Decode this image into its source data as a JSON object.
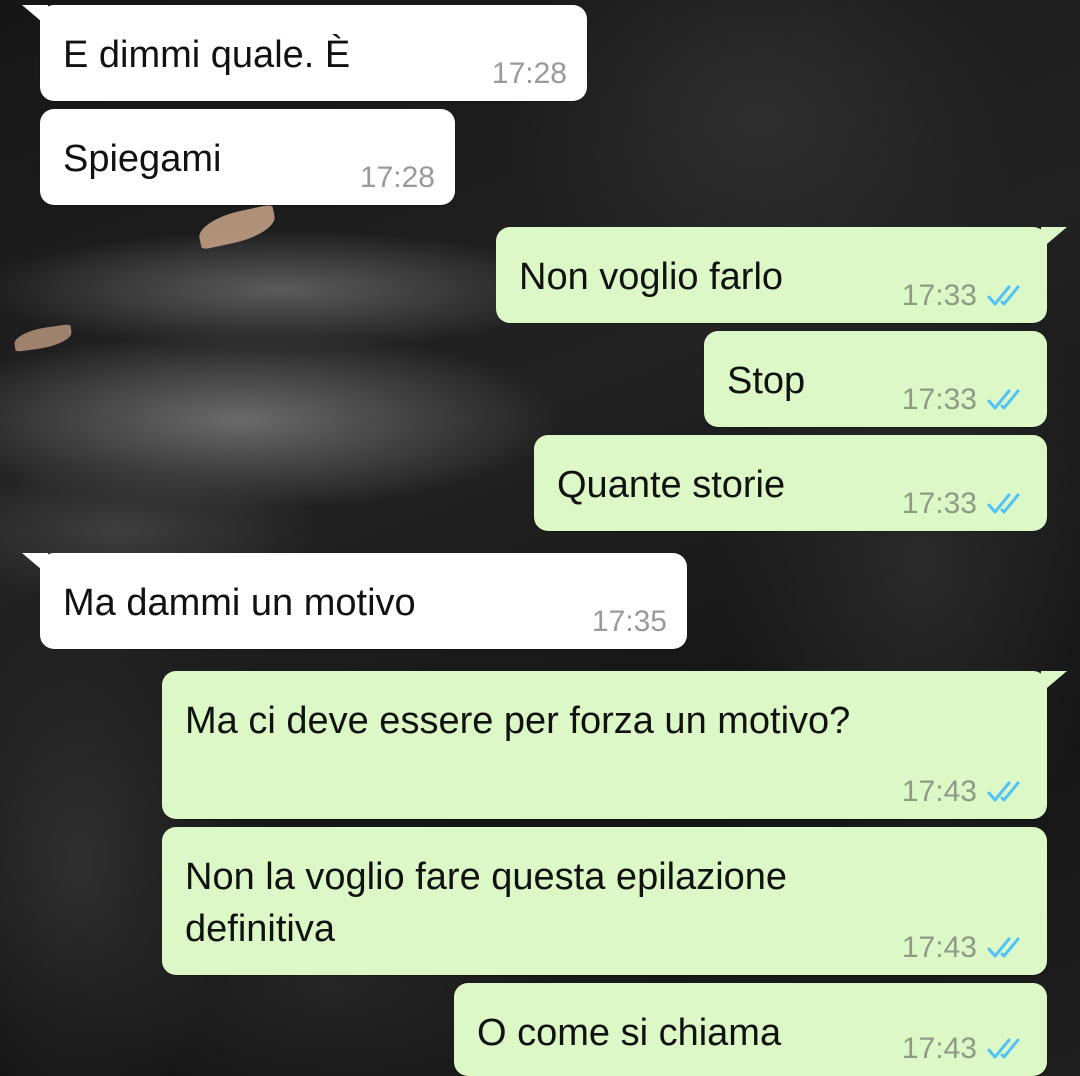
{
  "conversation": {
    "messages": [
      {
        "direction": "in",
        "text": "E dimmi quale. È",
        "time": "17:28"
      },
      {
        "direction": "in",
        "text": "Spiegami",
        "time": "17:28"
      },
      {
        "direction": "out",
        "text": "Non voglio farlo",
        "time": "17:33",
        "status": "read-ticks-icon"
      },
      {
        "direction": "out",
        "text": "Stop",
        "time": "17:33",
        "status": "read-ticks-icon"
      },
      {
        "direction": "out",
        "text": "Quante storie",
        "time": "17:33",
        "status": "read-ticks-icon"
      },
      {
        "direction": "in",
        "text": "Ma dammi un motivo",
        "time": "17:35"
      },
      {
        "direction": "out",
        "text": "Ma ci deve essere per forza un motivo?",
        "time": "17:43",
        "status": "read-ticks-icon"
      },
      {
        "direction": "out",
        "text": "Non la voglio fare questa epilazione definitiva",
        "time": "17:43",
        "status": "read-ticks-icon"
      },
      {
        "direction": "out",
        "text": "O come si chiama",
        "time": "17:43",
        "status": "read-ticks-icon"
      }
    ]
  },
  "colors": {
    "incoming_bubble": "#ffffff",
    "outgoing_bubble": "#dcf8c6",
    "read_ticks": "#4fc3f7",
    "timestamp": "#9a9a9a"
  }
}
